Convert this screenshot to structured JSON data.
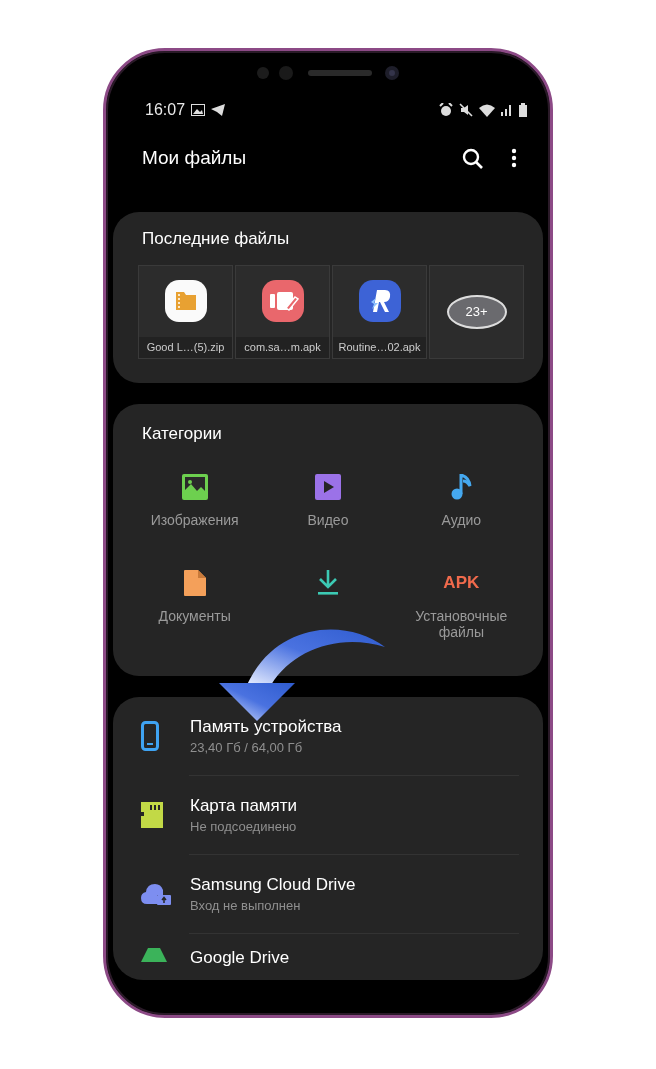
{
  "status_bar": {
    "time": "16:07"
  },
  "header": {
    "title": "Мои файлы"
  },
  "recent": {
    "title": "Последние файлы",
    "more": "23+",
    "files": [
      {
        "name": "Good L…(5).zip",
        "kind": "zip"
      },
      {
        "name": "com.sa…m.apk",
        "kind": "video-editor"
      },
      {
        "name": "Routine…02.apk",
        "kind": "routine"
      }
    ]
  },
  "categories": {
    "title": "Категории",
    "items": [
      {
        "label": "Изображения",
        "kind": "images"
      },
      {
        "label": "Видео",
        "kind": "video"
      },
      {
        "label": "Аудио",
        "kind": "audio"
      },
      {
        "label": "Документы",
        "kind": "documents"
      },
      {
        "kind": "downloads"
      },
      {
        "label": "Установочные файлы",
        "kind": "apk",
        "icon_text": "APK"
      }
    ]
  },
  "storage": [
    {
      "title": "Память устройства",
      "subtitle": "23,40 Гб / 64,00 Гб",
      "kind": "device"
    },
    {
      "title": "Карта памяти",
      "subtitle": "Не подсоединено",
      "kind": "sdcard"
    },
    {
      "title": "Samsung Cloud Drive",
      "subtitle": "Вход не выполнен",
      "kind": "cloud"
    },
    {
      "title": "Google Drive",
      "kind": "google"
    }
  ]
}
